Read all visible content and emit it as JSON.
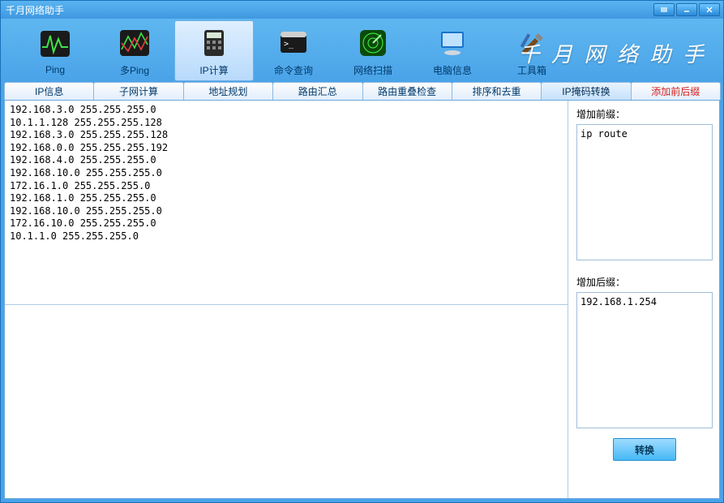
{
  "window": {
    "title": "千月网络助手"
  },
  "brand": "千 月 网 络 助 手",
  "toolbar": [
    {
      "id": "ping",
      "label": "Ping"
    },
    {
      "id": "mping",
      "label": "多Ping"
    },
    {
      "id": "ipcalc",
      "label": "IP计算"
    },
    {
      "id": "cmdq",
      "label": "命令查询"
    },
    {
      "id": "netscan",
      "label": "网络扫描"
    },
    {
      "id": "pcinfo",
      "label": "电脑信息"
    },
    {
      "id": "toolbox",
      "label": "工具箱"
    }
  ],
  "tabs": [
    {
      "id": "ipinfo",
      "label": "IP信息"
    },
    {
      "id": "subnet",
      "label": "子网计算"
    },
    {
      "id": "addrplan",
      "label": "地址规划"
    },
    {
      "id": "routesum",
      "label": "路由汇总"
    },
    {
      "id": "overlap",
      "label": "路由重叠检查"
    },
    {
      "id": "sortdedup",
      "label": "排序和去重"
    },
    {
      "id": "maskconv",
      "label": "IP掩码转换"
    },
    {
      "id": "prefsuf",
      "label": "添加前后缀"
    }
  ],
  "left": {
    "upper": "192.168.3.0 255.255.255.0\n10.1.1.128 255.255.255.128\n192.168.3.0 255.255.255.128\n192.168.0.0 255.255.255.192\n192.168.4.0 255.255.255.0\n192.168.10.0 255.255.255.0\n172.16.1.0 255.255.255.0\n192.168.1.0 255.255.255.0\n192.168.10.0 255.255.255.0\n172.16.10.0 255.255.255.0\n10.1.1.0 255.255.255.0",
    "lower": ""
  },
  "right": {
    "prefix_label": "增加前缀：",
    "prefix_value": "ip route",
    "suffix_label": "增加后缀：",
    "suffix_value": "192.168.1.254",
    "convert_label": "转换"
  }
}
